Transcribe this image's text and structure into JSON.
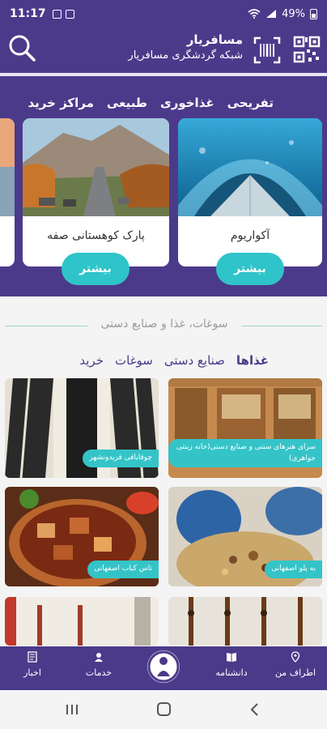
{
  "status_bar": {
    "time": "11:17",
    "battery": "49%"
  },
  "header": {
    "title": "مسافریار",
    "subtitle": "شبکه گردشگری مسافریار"
  },
  "category_tabs": [
    "تفریحی",
    "غذاخوری",
    "طبیعی",
    "مراکز خرید"
  ],
  "places": [
    {
      "title": "آکواریوم",
      "more_label": "بیشتر"
    },
    {
      "title": "پارک کوهستانی صفه",
      "more_label": "بیشتر"
    }
  ],
  "souvenirs": {
    "heading": "سوغات، غذا و صنایع دستی",
    "tabs": [
      "غذاها",
      "صنایع دستی",
      "سوغات",
      "خرید"
    ],
    "items": [
      {
        "label": "سرای هنرهای سنتی و صنایع دستی(خانه زینتی جواهری)"
      },
      {
        "label": "چوقابافی فریدونشهر"
      },
      {
        "label": "به پلو اصفهانی"
      },
      {
        "label": "تاس کباب اصفهانی"
      }
    ]
  },
  "bottom_nav": {
    "around": "اطراف من",
    "wiki": "دانشنامه",
    "services": "خدمات",
    "news": "اخبار"
  },
  "colors": {
    "primary": "#4b3a8a",
    "accent": "#2fc4c9"
  }
}
